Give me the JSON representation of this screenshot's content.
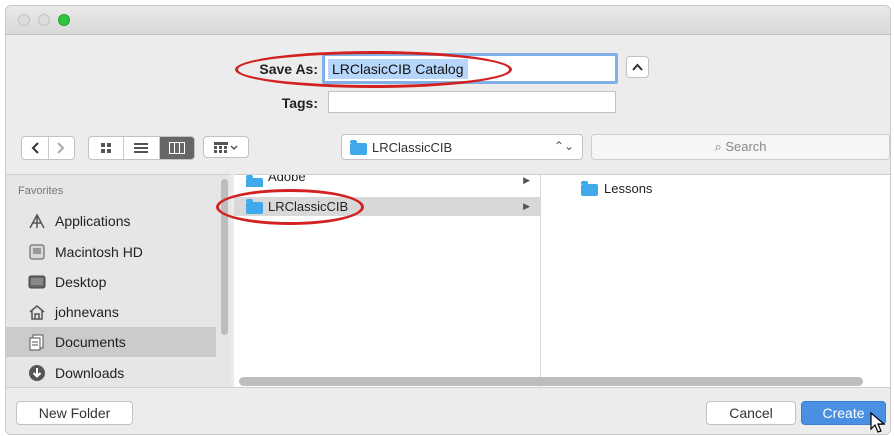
{
  "save_as": {
    "label": "Save As:",
    "value": "LRClasicCIB Catalog"
  },
  "tags": {
    "label": "Tags:",
    "value": ""
  },
  "location": {
    "folder": "LRClassicCIB"
  },
  "search": {
    "placeholder": "Search"
  },
  "sidebar": {
    "header": "Favorites",
    "items": [
      {
        "label": "Applications",
        "icon": "applications-icon"
      },
      {
        "label": "Macintosh HD",
        "icon": "disk-icon"
      },
      {
        "label": "Desktop",
        "icon": "desktop-icon"
      },
      {
        "label": "johnevans",
        "icon": "home-icon"
      },
      {
        "label": "Documents",
        "icon": "documents-icon",
        "selected": true
      },
      {
        "label": "Downloads",
        "icon": "downloads-icon"
      }
    ]
  },
  "browser": {
    "column1": [
      {
        "label": "Adobe",
        "has_children": true
      },
      {
        "label": "LRClassicCIB",
        "has_children": true,
        "selected": true
      }
    ],
    "column2": [
      {
        "label": "Lessons"
      }
    ]
  },
  "buttons": {
    "new_folder": "New Folder",
    "cancel": "Cancel",
    "create": "Create"
  },
  "colors": {
    "accent": "#4a90e2",
    "folder": "#3fa9ea",
    "annotation": "#d32020"
  }
}
